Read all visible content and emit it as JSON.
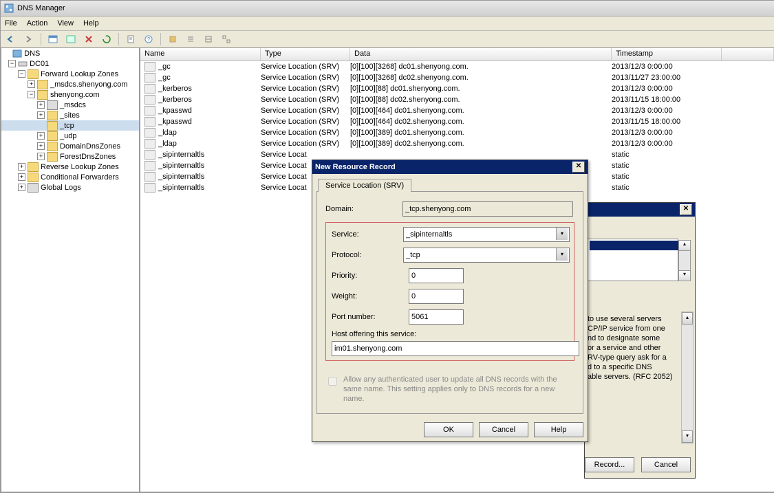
{
  "title": "DNS Manager",
  "menu": {
    "file": "File",
    "action": "Action",
    "view": "View",
    "help": "Help"
  },
  "tree": {
    "root": "DNS",
    "server": "DC01",
    "flz": "Forward Lookup Zones",
    "msdcs": "_msdcs.shenyong.com",
    "zone": "shenyong.com",
    "msdcs2": "_msdcs",
    "sites": "_sites",
    "tcp": "_tcp",
    "udp": "_udp",
    "ddz": "DomainDnsZones",
    "fdz": "ForestDnsZones",
    "rlz": "Reverse Lookup Zones",
    "cf": "Conditional Forwarders",
    "gl": "Global Logs"
  },
  "columns": {
    "name": "Name",
    "type": "Type",
    "data": "Data",
    "ts": "Timestamp"
  },
  "rows": [
    {
      "n": "_gc",
      "t": "Service Location (SRV)",
      "d": "[0][100][3268] dc01.shenyong.com.",
      "ts": "2013/12/3 0:00:00"
    },
    {
      "n": "_gc",
      "t": "Service Location (SRV)",
      "d": "[0][100][3268] dc02.shenyong.com.",
      "ts": "2013/11/27 23:00:00"
    },
    {
      "n": "_kerberos",
      "t": "Service Location (SRV)",
      "d": "[0][100][88] dc01.shenyong.com.",
      "ts": "2013/12/3 0:00:00"
    },
    {
      "n": "_kerberos",
      "t": "Service Location (SRV)",
      "d": "[0][100][88] dc02.shenyong.com.",
      "ts": "2013/11/15 18:00:00"
    },
    {
      "n": "_kpasswd",
      "t": "Service Location (SRV)",
      "d": "[0][100][464] dc01.shenyong.com.",
      "ts": "2013/12/3 0:00:00"
    },
    {
      "n": "_kpasswd",
      "t": "Service Location (SRV)",
      "d": "[0][100][464] dc02.shenyong.com.",
      "ts": "2013/11/15 18:00:00"
    },
    {
      "n": "_ldap",
      "t": "Service Location (SRV)",
      "d": "[0][100][389] dc01.shenyong.com.",
      "ts": "2013/12/3 0:00:00"
    },
    {
      "n": "_ldap",
      "t": "Service Location (SRV)",
      "d": "[0][100][389] dc02.shenyong.com.",
      "ts": "2013/12/3 0:00:00"
    },
    {
      "n": "_sipinternaltls",
      "t": "Service Locat",
      "d": "",
      "ts": "static"
    },
    {
      "n": "_sipinternaltls",
      "t": "Service Locat",
      "d": "",
      "ts": "static"
    },
    {
      "n": "_sipinternaltls",
      "t": "Service Locat",
      "d": "",
      "ts": "static"
    },
    {
      "n": "_sipinternaltls",
      "t": "Service Locat",
      "d": "",
      "ts": "static"
    }
  ],
  "dlg": {
    "title": "New Resource Record",
    "tab": "Service Location (SRV)",
    "labels": {
      "domain": "Domain:",
      "service": "Service:",
      "protocol": "Protocol:",
      "priority": "Priority:",
      "weight": "Weight:",
      "port": "Port number:",
      "host": "Host offering this service:"
    },
    "domain": "_tcp.shenyong.com",
    "service": "_sipinternaltls",
    "protocol": "_tcp",
    "priority": "0",
    "weight": "0",
    "port": "5061",
    "host": "im01.shenyong.com",
    "allow": "Allow any authenticated user to update all DNS records with the same name. This setting applies only to DNS records for a new name.",
    "ok": "OK",
    "cancel": "Cancel",
    "help": "Help"
  },
  "bgdlg": {
    "desc": "to use several servers\nCP/IP service from one\nnd to designate some\nor a service and other\nRV-type query ask for a\nd to a specific DNS\nable servers. (RFC 2052)",
    "record": "Record...",
    "cancel": "Cancel"
  }
}
